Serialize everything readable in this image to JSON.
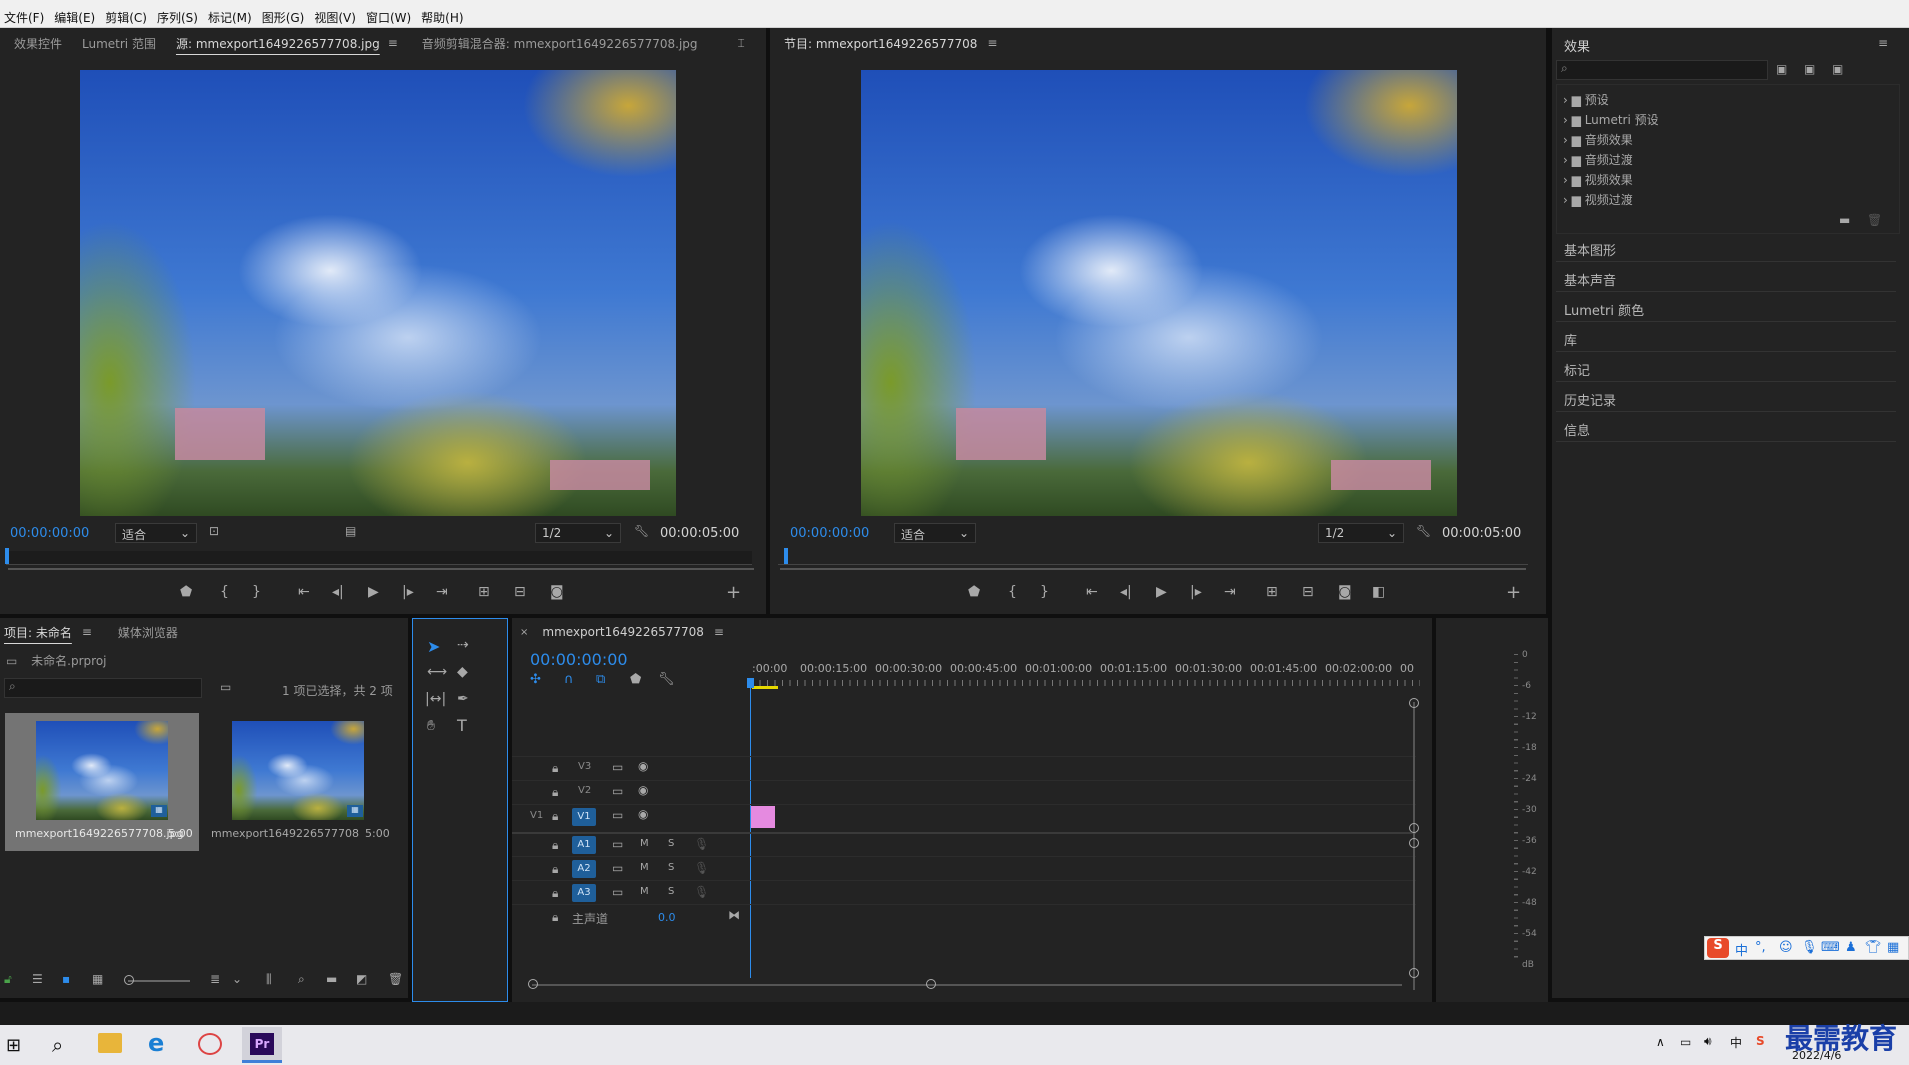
{
  "menubar": {
    "items": [
      "文件(F)",
      "编辑(E)",
      "剪辑(C)",
      "序列(S)",
      "标记(M)",
      "图形(G)",
      "视图(V)",
      "窗口(W)",
      "帮助(H)"
    ]
  },
  "source": {
    "tabs": [
      "效果控件",
      "Lumetri 范围",
      "源: mmexport1649226577708.jpg",
      "音频剪辑混合器: mmexport1649226577708.jpg"
    ],
    "timecode": "00:00:00:00",
    "fit": "适合",
    "resolution": "1/2",
    "duration": "00:00:05:00"
  },
  "program": {
    "tab": "节目: mmexport1649226577708",
    "timecode": "00:00:00:00",
    "fit": "适合",
    "resolution": "1/2",
    "duration": "00:00:05:00"
  },
  "effects": {
    "title": "效果",
    "tree": [
      "预设",
      "Lumetri 预设",
      "音频效果",
      "音频过渡",
      "视频效果",
      "视频过渡"
    ],
    "panels": [
      "基本图形",
      "基本声音",
      "Lumetri 颜色",
      "库",
      "标记",
      "历史记录",
      "信息"
    ]
  },
  "project": {
    "tabs": [
      "项目: 未命名",
      "媒体浏览器"
    ],
    "file": "未命名.prproj",
    "selection": "1 项已选择，共 2 项",
    "items": [
      {
        "name": "mmexport1649226577708.jpg",
        "duration": "5:00"
      },
      {
        "name": "mmexport1649226577708",
        "duration": "5:00"
      }
    ]
  },
  "timeline": {
    "tab": "mmexport1649226577708",
    "timecode": "00:00:00:00",
    "ruler": [
      ":00:00",
      "00:00:15:00",
      "00:00:30:00",
      "00:00:45:00",
      "00:01:00:00",
      "00:01:15:00",
      "00:01:30:00",
      "00:01:45:00",
      "00:02:00:00",
      "00"
    ],
    "video_tracks": [
      "V3",
      "V2",
      "V1"
    ],
    "audio_tracks": [
      "A1",
      "A2",
      "A3"
    ],
    "source_patch": "V1",
    "master": "主声道",
    "master_value": "0.0",
    "clip_color": "#e58ae0"
  },
  "meter": {
    "labels": [
      "0",
      "-6",
      "-12",
      "-18",
      "-24",
      "-30",
      "-36",
      "-42",
      "-48",
      "-54",
      "dB"
    ]
  },
  "ime": {
    "chars": [
      "中",
      "°,"
    ]
  },
  "taskbar": {
    "date": "2022/4/6",
    "watermark": "最需教育"
  },
  "colors": {
    "accent": "#2d8ceb",
    "panel": "#232323"
  }
}
